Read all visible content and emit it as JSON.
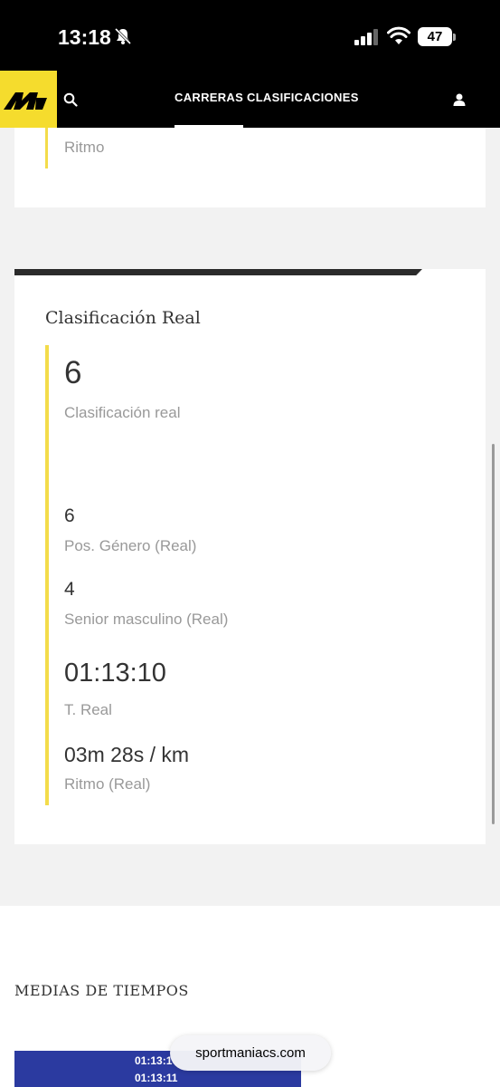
{
  "status_bar": {
    "time": "13:18",
    "battery": "47"
  },
  "nav": {
    "tabs": [
      {
        "label": "CARRERAS",
        "active": true
      },
      {
        "label": "CLASIFICACIONES",
        "active": false
      }
    ]
  },
  "card_top": {
    "label": "Ritmo"
  },
  "real_card": {
    "title": "Clasificación Real",
    "items": [
      {
        "value": "6",
        "label": "Clasificación real"
      },
      {
        "value": "6",
        "label": "Pos. Género (Real)"
      },
      {
        "value": "4",
        "label": "Senior masculino (Real)"
      },
      {
        "value": "01:13:10",
        "label": "T. Real"
      },
      {
        "value": "03m 28s / km",
        "label": "Ritmo (Real)"
      }
    ]
  },
  "medias": {
    "title": "MEDIAS DE TIEMPOS",
    "times": [
      "01:13:1",
      "01:13:11"
    ]
  },
  "browser": {
    "url": "sportmaniacs.com"
  },
  "colors": {
    "accent": "#f3dc4a",
    "brand_yellow": "#f5dc2d",
    "header_bg": "#000000",
    "medias_blue": "#2b3aa0"
  }
}
